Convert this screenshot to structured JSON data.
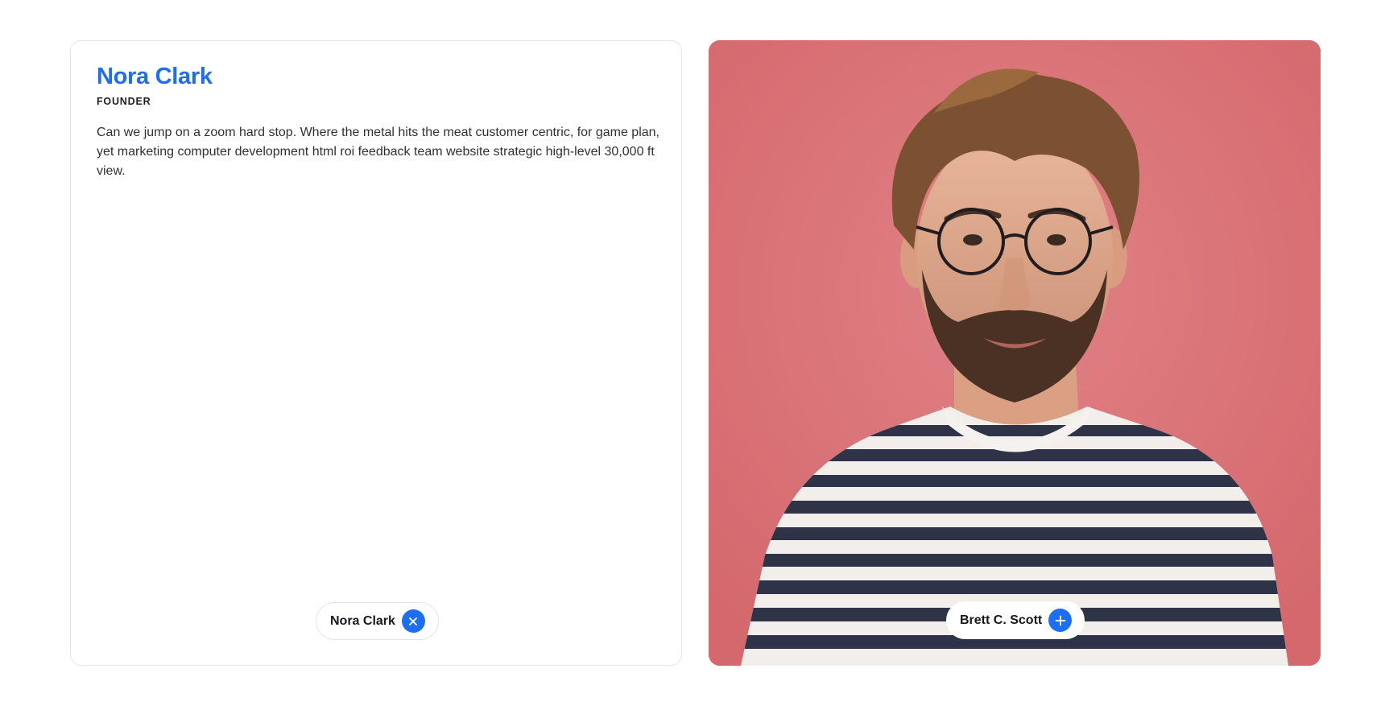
{
  "profile": {
    "name": "Nora Clark",
    "role": "FOUNDER",
    "bio": "Can we jump on a zoom hard stop. Where the metal hits the meat customer centric, for game plan, yet marketing computer development html roi feedback team website strategic high-level 30,000 ft view."
  },
  "pills": {
    "active": {
      "label": "Nora Clark",
      "icon": "close-icon"
    },
    "inactive": {
      "label": "Brett C. Scott",
      "icon": "plus-icon"
    }
  },
  "colors": {
    "accent": "#1d6ef0",
    "photo_background": "#d97377"
  }
}
